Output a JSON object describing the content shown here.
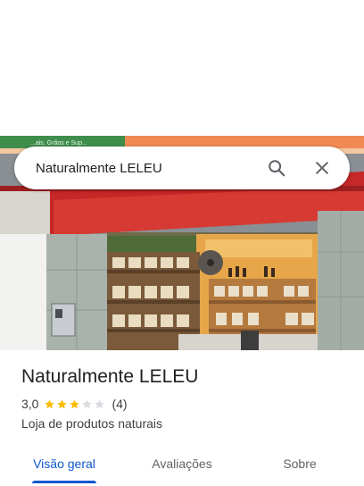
{
  "search": {
    "query": "Naturalmente LELEU"
  },
  "icons": {
    "search": "search-icon",
    "close": "close-icon",
    "star": "star-icon"
  },
  "photo": {
    "sign_text": "...ais, Grãos e Sup..."
  },
  "place": {
    "name": "Naturalmente LELEU",
    "rating": "3,0",
    "stars_filled": 3,
    "stars_total": 5,
    "review_count": "(4)",
    "category": "Loja de produtos naturais"
  },
  "tabs": [
    {
      "label": "Visão geral",
      "active": true
    },
    {
      "label": "Avaliações",
      "active": false
    },
    {
      "label": "Sobre",
      "active": false
    }
  ],
  "colors": {
    "accent": "#0b57d0",
    "star_filled": "#fbbc04",
    "star_empty": "#dadce0",
    "storefront_red": "#c62828"
  }
}
